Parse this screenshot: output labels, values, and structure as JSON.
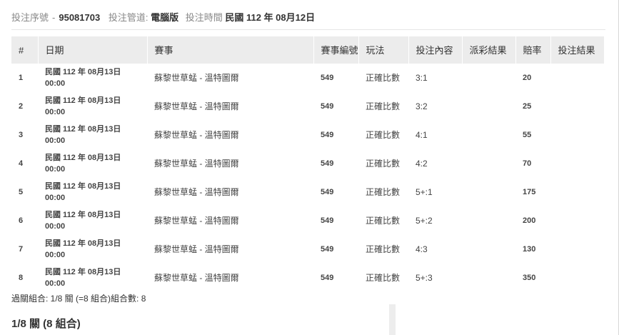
{
  "bet_info": {
    "serial_label": "投注序號",
    "serial_sep": "-",
    "serial_value": "95081703",
    "channel_label": "投注管道:",
    "channel_value": "電腦版",
    "time_label": "投注時間",
    "time_value": "民國 112 年 08月12日"
  },
  "table": {
    "headers": [
      "#",
      "日期",
      "賽事",
      "賽事編號",
      "玩法",
      "投注內容",
      "派彩結果",
      "賠率",
      "投注結果"
    ],
    "rows": [
      {
        "no": "1",
        "date": "民國 112 年 08月13日",
        "time": "00:00",
        "match": "蘇黎世草蜢 - 溫特圖爾",
        "match_no": "549",
        "play": "正確比數",
        "content": "3:1",
        "payout": "",
        "odds": "20",
        "result": ""
      },
      {
        "no": "2",
        "date": "民國 112 年 08月13日",
        "time": "00:00",
        "match": "蘇黎世草蜢 - 溫特圖爾",
        "match_no": "549",
        "play": "正確比數",
        "content": "3:2",
        "payout": "",
        "odds": "25",
        "result": ""
      },
      {
        "no": "3",
        "date": "民國 112 年 08月13日",
        "time": "00:00",
        "match": "蘇黎世草蜢 - 溫特圖爾",
        "match_no": "549",
        "play": "正確比數",
        "content": "4:1",
        "payout": "",
        "odds": "55",
        "result": ""
      },
      {
        "no": "4",
        "date": "民國 112 年 08月13日",
        "time": "00:00",
        "match": "蘇黎世草蜢 - 溫特圖爾",
        "match_no": "549",
        "play": "正確比數",
        "content": "4:2",
        "payout": "",
        "odds": "70",
        "result": ""
      },
      {
        "no": "5",
        "date": "民國 112 年 08月13日",
        "time": "00:00",
        "match": "蘇黎世草蜢 - 溫特圖爾",
        "match_no": "549",
        "play": "正確比數",
        "content": "5+:1",
        "payout": "",
        "odds": "175",
        "result": ""
      },
      {
        "no": "6",
        "date": "民國 112 年 08月13日",
        "time": "00:00",
        "match": "蘇黎世草蜢 - 溫特圖爾",
        "match_no": "549",
        "play": "正確比數",
        "content": "5+:2",
        "payout": "",
        "odds": "200",
        "result": ""
      },
      {
        "no": "7",
        "date": "民國 112 年 08月13日",
        "time": "00:00",
        "match": "蘇黎世草蜢 - 溫特圖爾",
        "match_no": "549",
        "play": "正確比數",
        "content": "4:3",
        "payout": "",
        "odds": "130",
        "result": ""
      },
      {
        "no": "8",
        "date": "民國 112 年 08月13日",
        "time": "00:00",
        "match": "蘇黎世草蜢 - 溫特圖爾",
        "match_no": "549",
        "play": "正確比數",
        "content": "5+:3",
        "payout": "",
        "odds": "350",
        "result": ""
      }
    ]
  },
  "summary": "過關組合: 1/8 關 (=8 組合)組合數: 8",
  "combo_title": "1/8 關 (8 組合)"
}
